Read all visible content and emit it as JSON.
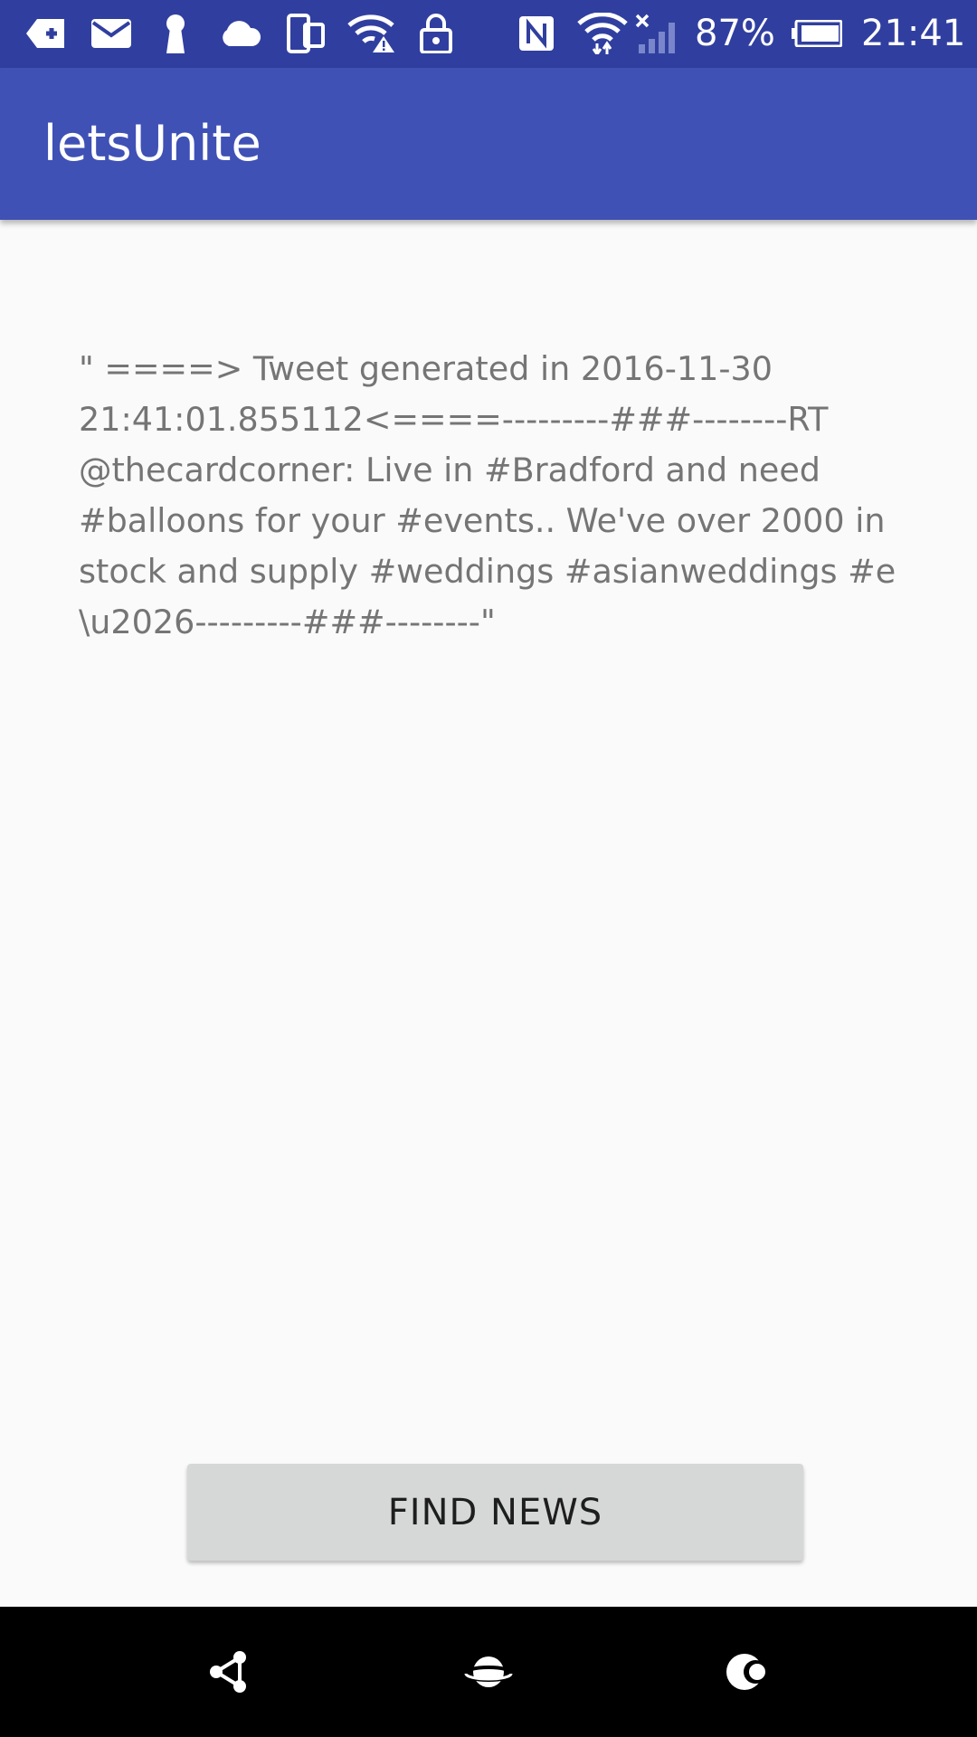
{
  "status_bar": {
    "battery_text": "87%",
    "time": "21:41",
    "icons": [
      "delete-key-icon",
      "mail-icon",
      "keyhole-icon",
      "cloud-icon",
      "dual-screen-icon",
      "wifi-alert-icon",
      "lock-icon",
      "nfc-icon",
      "wifi-icon",
      "signal-off-icon",
      "battery-icon"
    ]
  },
  "app_bar": {
    "title": "letsUnite"
  },
  "main": {
    "tweet_text": "\" ====> Tweet generated in 2016-11-30\n21:41:01.855112<====---------###--------RT\n@thecardcorner: Live in #Bradford and need\n#balloons for your #events.. We've over 2000 in\nstock and supply #weddings #asianweddings #e\n\\u2026---------###--------\""
  },
  "find_button": {
    "label": "FIND NEWS"
  },
  "nav_bar": {
    "icons": [
      "share-nodes-icon",
      "planet-icon",
      "moon-icon"
    ]
  },
  "colors": {
    "status_bar": "#303f9f",
    "app_bar": "#3f51b5",
    "background": "#fafafa",
    "text": "#757575",
    "button": "#d6d7d7"
  }
}
